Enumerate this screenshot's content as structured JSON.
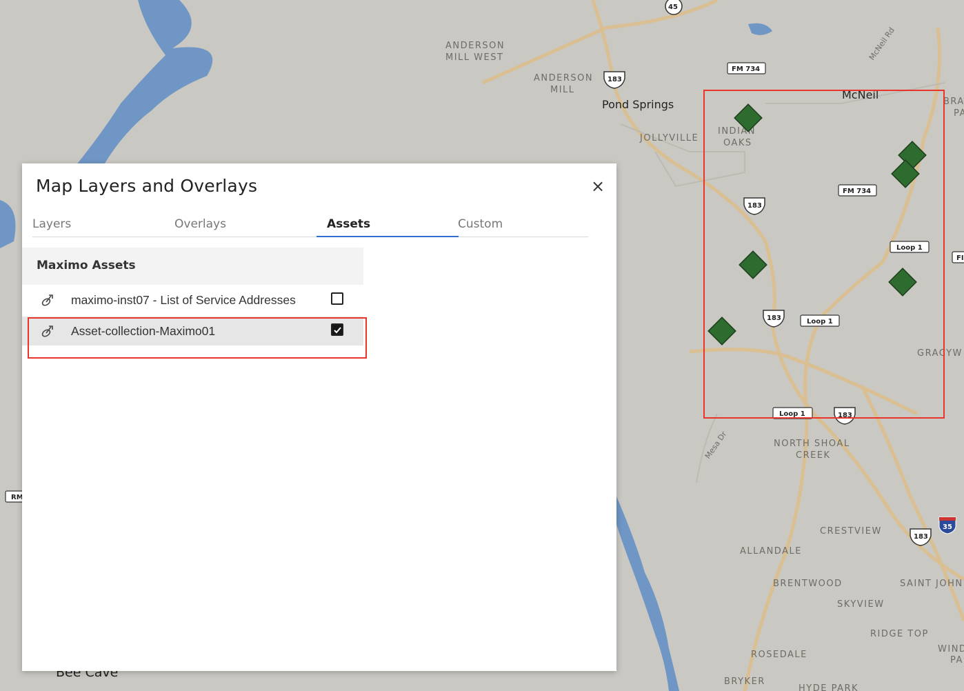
{
  "dialog": {
    "title": "Map Layers and Overlays",
    "close_label": "×",
    "tabs": [
      {
        "label": "Layers",
        "active": false
      },
      {
        "label": "Overlays",
        "active": false
      },
      {
        "label": "Assets",
        "active": true
      },
      {
        "label": "Custom",
        "active": false
      }
    ],
    "section_title": "Maximo Assets",
    "items": [
      {
        "label": "maximo-inst07 - List of Service Addresses",
        "checked": false,
        "icon": "asset-icon"
      },
      {
        "label": "Asset-collection-Maximo01",
        "checked": true,
        "icon": "asset-icon"
      }
    ]
  },
  "map": {
    "places": [
      "ANDERSON",
      "MILL WEST",
      "ANDERSON",
      "MILL",
      "Pond Springs",
      "JOLLYVILLE",
      "INDIAN",
      "OAKS",
      "McNeil",
      "NORTH SHOAL",
      "CREEK",
      "CRESTVIEW",
      "ALLANDALE",
      "BRENTWOOD",
      "SKYVIEW",
      "SAINT JOHN",
      "RIDGE TOP",
      "ROSEDALE",
      "BRYKER",
      "HYDE PARK",
      "GRACYW",
      "WIND",
      "PA",
      "BRA",
      "PA",
      "Bee Cave",
      "McNeil Rd",
      "Mesa Dr"
    ],
    "shields": [
      "45",
      "183",
      "FM 734",
      "183",
      "FM 734",
      "Loop 1",
      "183",
      "Loop 1",
      "Loop 1",
      "183",
      "183",
      "35",
      "RM",
      "FI"
    ],
    "marker_color": "#2e6b2e",
    "accent": "#2f6fd1",
    "highlight_color": "#e8342a",
    "water_color": "#6f96c4"
  }
}
